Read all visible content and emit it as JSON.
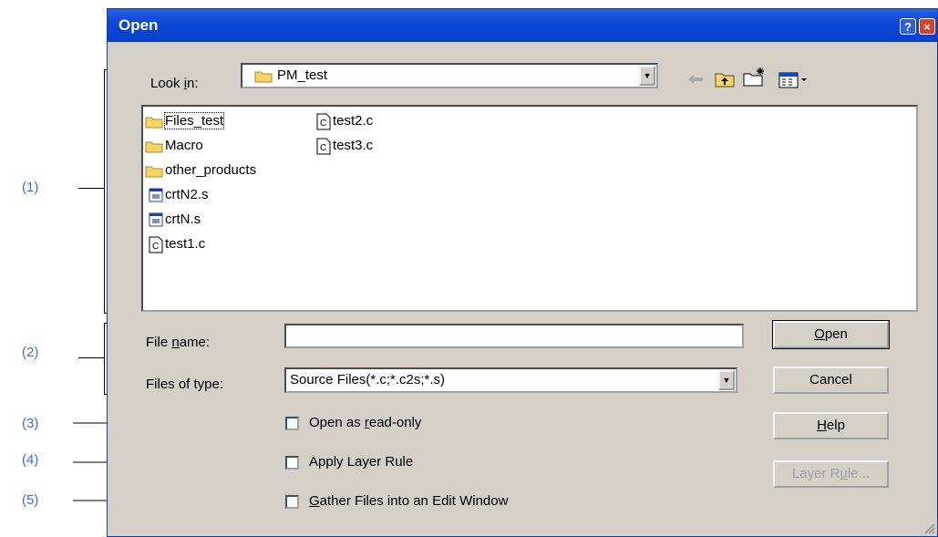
{
  "dialog": {
    "title": "Open",
    "title_buttons": {
      "help": "?",
      "close": "×"
    }
  },
  "look_in": {
    "label_pre": "Look ",
    "label_accel": "i",
    "label_post": "n:",
    "value": "PM_test"
  },
  "toolbar": {
    "icons": [
      "back-arrow-icon",
      "up-one-level-icon",
      "new-folder-icon",
      "view-menu-icon"
    ]
  },
  "files": {
    "col1": [
      {
        "name": "Files_test",
        "icon": "folder-icon"
      },
      {
        "name": "Macro",
        "icon": "folder-icon"
      },
      {
        "name": "other_products",
        "icon": "folder-icon"
      },
      {
        "name": "crtN2.s",
        "icon": "asm-file-icon"
      },
      {
        "name": "crtN.s",
        "icon": "asm-file-icon"
      },
      {
        "name": "test1.c",
        "icon": "c-file-icon"
      }
    ],
    "col2": [
      {
        "name": "test2.c",
        "icon": "c-file-icon"
      },
      {
        "name": "test3.c",
        "icon": "c-file-icon"
      }
    ]
  },
  "file_name": {
    "label_pre": "File ",
    "label_accel": "n",
    "label_post": "ame:",
    "value": ""
  },
  "files_of_type": {
    "label": "Files of type:",
    "value": "Source Files(*.c;*.c2s;*.s)"
  },
  "options": {
    "read_only": {
      "pre": "Open as ",
      "accel": "r",
      "post": "ead-only"
    },
    "layer_rule": {
      "pre": "",
      "accel": "",
      "post": "Apply Layer Rule"
    },
    "gather": {
      "pre": "",
      "accel": "G",
      "post": "ather Files into an Edit Window"
    }
  },
  "buttons": {
    "open": {
      "accel": "O",
      "rest": "pen"
    },
    "cancel": "Cancel",
    "help": {
      "accel": "H",
      "rest": "elp"
    },
    "layer_rule": {
      "pre": "Layer R",
      "accel": "u",
      "post": "le..."
    }
  },
  "annotations": [
    "(1)",
    "(2)",
    "(3)",
    "(4)",
    "(5)"
  ],
  "colors": {
    "title_bar": "#0a46d8",
    "annotation": "#3a6fd8",
    "dialog_face": "#d4d0c8"
  }
}
